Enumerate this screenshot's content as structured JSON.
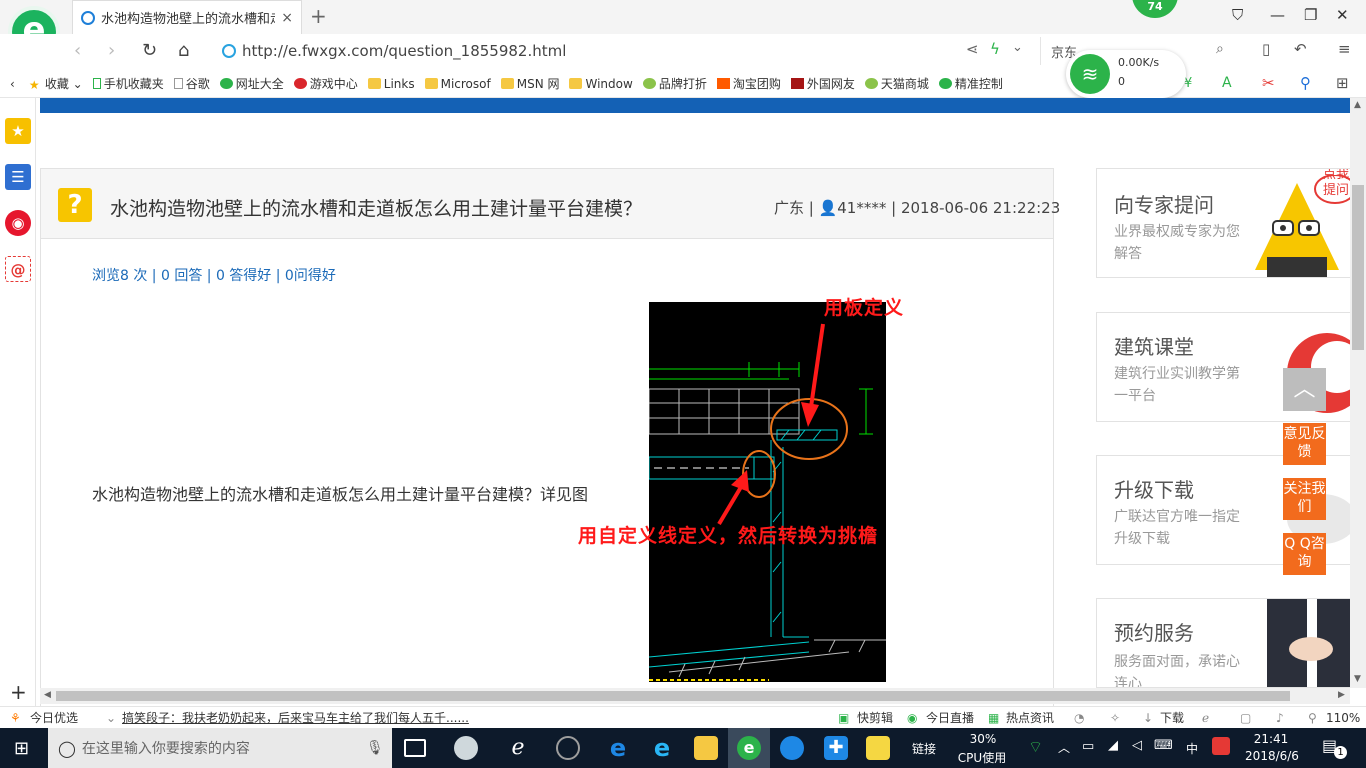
{
  "browser": {
    "tab_title": "水池构造物池壁上的流水槽和走道",
    "tab_close": "×",
    "newtab": "+",
    "badge": "74",
    "url": "http://e.fwxgx.com/question_1855982.html",
    "search_text": "京东",
    "logo_letter": "e"
  },
  "bookmarks": [
    {
      "label": "收藏",
      "icon": "star-icon"
    },
    {
      "label": "手机收藏夹",
      "icon": "phone-icon"
    },
    {
      "label": "谷歌",
      "icon": "page-icon"
    },
    {
      "label": "网址大全",
      "icon": "globe-icon"
    },
    {
      "label": "游戏中心",
      "icon": "game-icon"
    },
    {
      "label": "Links",
      "icon": "folder-icon"
    },
    {
      "label": "Microsof",
      "icon": "folder-icon"
    },
    {
      "label": "MSN 网",
      "icon": "folder-icon"
    },
    {
      "label": "Window",
      "icon": "folder-icon"
    },
    {
      "label": "品牌打折",
      "icon": "leaf-icon"
    },
    {
      "label": "淘宝团购",
      "icon": "taobao-icon"
    },
    {
      "label": "外国网友",
      "icon": "flag-icon"
    },
    {
      "label": "天猫商城",
      "icon": "leaf-icon"
    },
    {
      "label": "精准控制",
      "icon": "chat-icon"
    }
  ],
  "netwidget": {
    "speed": "0.00K/s",
    "count": "0"
  },
  "question": {
    "title": "水池构造物池壁上的流水槽和走道板怎么用土建计量平台建模？",
    "meta": "广东 | 👤41**** | 2018-06-06 21:22:23",
    "stats": "浏览8 次 | 0 回答 | 0 答得好 | 0问得好",
    "body": "水池构造物池壁上的流水槽和走道板怎么用土建计量平台建模？详见图",
    "annotation_top": "用板定义",
    "annotation_bottom": "用自定义线定义，然后转换为挑檐"
  },
  "right": [
    {
      "heading": "向专家提问",
      "sub": "业界最权威专家为您解答"
    },
    {
      "heading": "建筑课堂",
      "sub": "建筑行业实训教学第一平台"
    },
    {
      "heading": "升级下载",
      "sub": "广联达官方唯一指定升级下载"
    },
    {
      "heading": "预约服务",
      "sub": "服务面对面，承诺心连心"
    }
  ],
  "floating": {
    "feedback": "意见反馈",
    "follow": "关注我们",
    "qq": "Q Q咨询",
    "bubble": "点我提问"
  },
  "infobar": {
    "today": "今日优选",
    "news": "搞笑段子：我扶老奶奶起来，后来宝马车主给了我们每人五千......",
    "kuaijian": "快剪辑",
    "live": "今日直播",
    "hot": "热点资讯",
    "download": "下载",
    "zoom": "110%"
  },
  "taskbar": {
    "search_placeholder": "在这里输入你要搜索的内容",
    "link": "链接",
    "cpu_pct": "30%",
    "cpu_label": "CPU使用",
    "ime": "中",
    "time": "21:41",
    "date": "2018/6/6",
    "notif": "1"
  }
}
